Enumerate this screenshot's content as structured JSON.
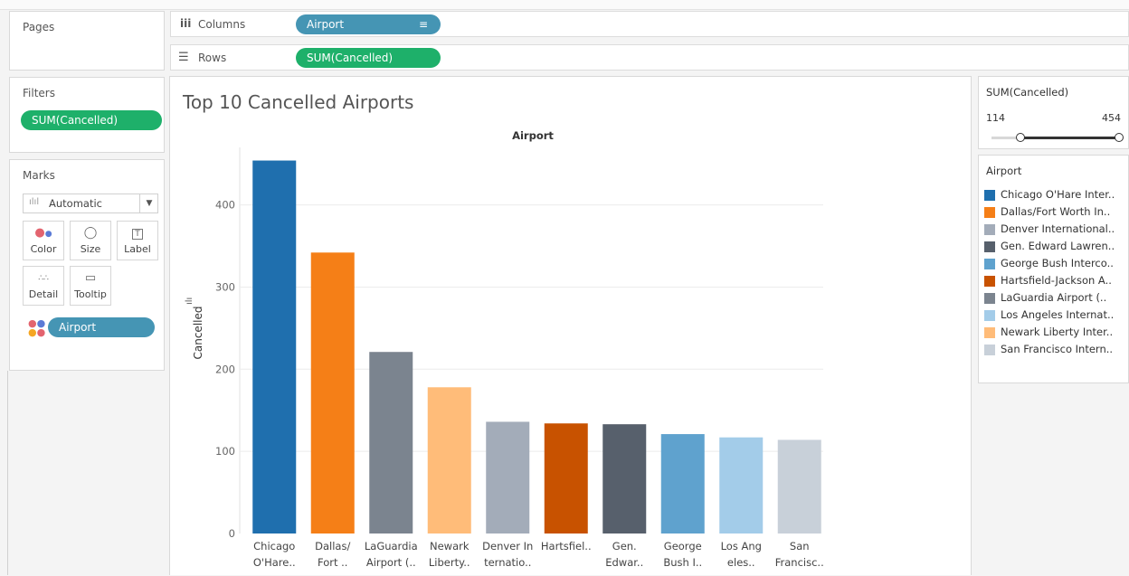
{
  "shelves": {
    "pages_label": "Pages",
    "columns_label": "Columns",
    "rows_label": "Rows",
    "columns_pill": "Airport",
    "rows_pill": "SUM(Cancelled)"
  },
  "filters": {
    "title": "Filters",
    "pill": "SUM(Cancelled)"
  },
  "marks": {
    "title": "Marks",
    "type_select": "Automatic",
    "buttons": [
      "Color",
      "Size",
      "Label",
      "Detail",
      "Tooltip"
    ],
    "color_pill": "Airport"
  },
  "sheet": {
    "title": "Top 10 Cancelled Airports"
  },
  "filter_card": {
    "title": "SUM(Cancelled)",
    "min": "114",
    "max": "454"
  },
  "legend": {
    "title": "Airport",
    "items": [
      {
        "label": "Chicago O'Hare Inter..",
        "color": "#1f6fae"
      },
      {
        "label": "Dallas/Fort Worth In..",
        "color": "#f57f17"
      },
      {
        "label": "Denver International..",
        "color": "#a3acb9"
      },
      {
        "label": "Gen. Edward Lawren..",
        "color": "#57606c"
      },
      {
        "label": "George Bush Interco..",
        "color": "#5fa2ce"
      },
      {
        "label": "Hartsfield-Jackson A..",
        "color": "#c85200"
      },
      {
        "label": "LaGuardia Airport (..",
        "color": "#7b848f"
      },
      {
        "label": "Los Angeles Internat..",
        "color": "#a3cce9"
      },
      {
        "label": "Newark Liberty Inter..",
        "color": "#ffbc79"
      },
      {
        "label": "San Francisco Intern..",
        "color": "#c8d0d9"
      }
    ]
  },
  "chart_data": {
    "type": "bar",
    "title": "Top 10 Cancelled Airports",
    "header": "Airport",
    "ylabel": "Cancelled",
    "ylim": [
      0,
      470
    ],
    "yticks": [
      0,
      100,
      200,
      300,
      400
    ],
    "grid": true,
    "categories": [
      [
        "Chicago",
        "O'Hare.."
      ],
      [
        "Dallas/",
        "Fort .."
      ],
      [
        "LaGuardia",
        "Airport (.."
      ],
      [
        "Newark",
        "Liberty.."
      ],
      [
        "Denver In",
        "ternatio.."
      ],
      [
        "Hartsfiel..",
        ""
      ],
      [
        "Gen.",
        "Edwar.."
      ],
      [
        "George",
        "Bush I.."
      ],
      [
        "Los Ang",
        "eles.."
      ],
      [
        "San",
        "Francisc.."
      ]
    ],
    "values": [
      454,
      342,
      221,
      178,
      136,
      134,
      133,
      121,
      117,
      114
    ],
    "colors": [
      "#1f6fae",
      "#f57f17",
      "#7b848f",
      "#ffbc79",
      "#a3acb9",
      "#c85200",
      "#57606c",
      "#5fa2ce",
      "#a3cce9",
      "#c8d0d9"
    ]
  }
}
